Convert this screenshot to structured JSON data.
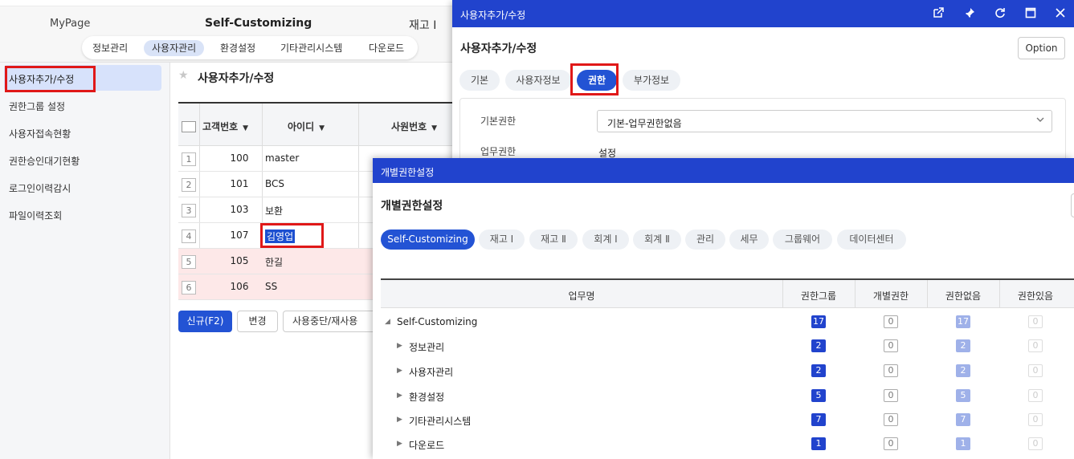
{
  "header": {
    "mypage": "MyPage",
    "self_customizing": "Self-Customizing",
    "stock": "재고 Ⅰ",
    "subnav": [
      "정보관리",
      "사용자관리",
      "환경설정",
      "기타관리시스템",
      "다운로드"
    ]
  },
  "sidebar": {
    "items": [
      "사용자추가/수정",
      "권한그룹 설정",
      "사용자접속현황",
      "권한승인대기현황",
      "로그인이력감시",
      "파일이력조회"
    ]
  },
  "main": {
    "title": "사용자추가/수정",
    "columns": [
      "고객번호",
      "아이디",
      "사원번호"
    ],
    "rows": [
      {
        "num": "1",
        "code": "100",
        "id": "master"
      },
      {
        "num": "2",
        "code": "101",
        "id": "BCS"
      },
      {
        "num": "3",
        "code": "103",
        "id": "보환"
      },
      {
        "num": "4",
        "code": "107",
        "id": "김영업"
      },
      {
        "num": "5",
        "code": "105",
        "id": "한길"
      },
      {
        "num": "6",
        "code": "106",
        "id": "SS"
      }
    ],
    "buttons": {
      "new": "신규(F2)",
      "edit": "변경",
      "suspend": "사용중단/재사용"
    }
  },
  "popup1": {
    "title": "사용자추가/수정",
    "heading": "사용자추가/수정",
    "option": "Option",
    "tabs": [
      "기본",
      "사용자정보",
      "권한",
      "부가정보"
    ],
    "basic_auth_label": "기본권한",
    "basic_auth_value": "기본-업무권한없음",
    "work_auth_label": "업무권한",
    "work_auth_value": "설정"
  },
  "popup2": {
    "title": "개별권한설정",
    "heading": "개별권한설정",
    "chips": [
      "Self-Customizing",
      "재고 Ⅰ",
      "재고 Ⅱ",
      "회계 Ⅰ",
      "회계 Ⅱ",
      "관리",
      "세무",
      "그룹웨어",
      "데이터센터"
    ],
    "columns": [
      "업무명",
      "권한그룹",
      "개별권한",
      "권한없음",
      "권한있음"
    ],
    "rows": [
      {
        "name": "Self-Customizing",
        "group": "17",
        "individual": "0",
        "none": "17",
        "has": "0"
      },
      {
        "name": "정보관리",
        "group": "2",
        "individual": "0",
        "none": "2",
        "has": "0"
      },
      {
        "name": "사용자관리",
        "group": "2",
        "individual": "0",
        "none": "2",
        "has": "0"
      },
      {
        "name": "환경설정",
        "group": "5",
        "individual": "0",
        "none": "5",
        "has": "0"
      },
      {
        "name": "기타관리시스템",
        "group": "7",
        "individual": "0",
        "none": "7",
        "has": "0"
      },
      {
        "name": "다운로드",
        "group": "1",
        "individual": "0",
        "none": "1",
        "has": "0"
      }
    ]
  }
}
